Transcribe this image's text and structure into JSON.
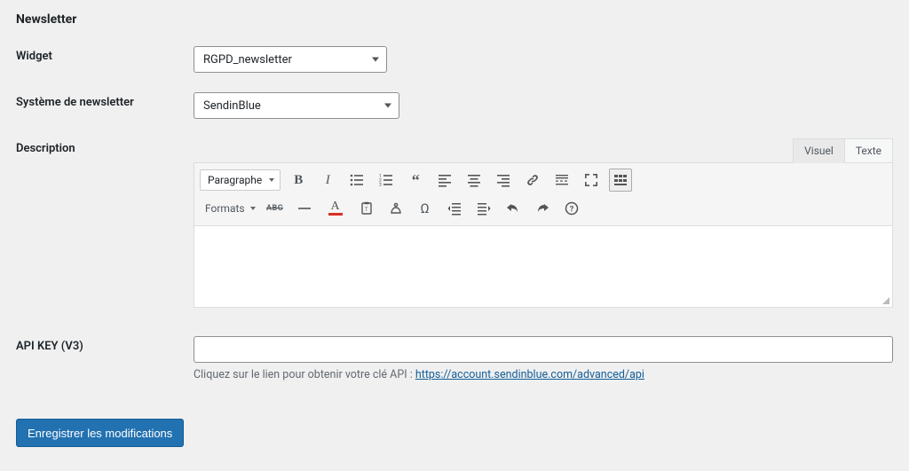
{
  "section_title": "Newsletter",
  "labels": {
    "widget": "Widget",
    "system": "Système de newsletter",
    "description": "Description",
    "api_key": "API KEY (V3)"
  },
  "widget_select": {
    "value": "RGPD_newsletter"
  },
  "system_select": {
    "value": "SendinBlue"
  },
  "editor": {
    "tab_visual": "Visuel",
    "tab_text": "Texte",
    "paragraph": "Paragraphe",
    "formats": "Formats",
    "abc": "ABC"
  },
  "api_key_value": "",
  "api_help_prefix": "Cliquez sur le lien pour obtenir votre clé API : ",
  "api_help_link_text": "https://account.sendinblue.com/advanced/api",
  "submit": "Enregistrer les modifications"
}
